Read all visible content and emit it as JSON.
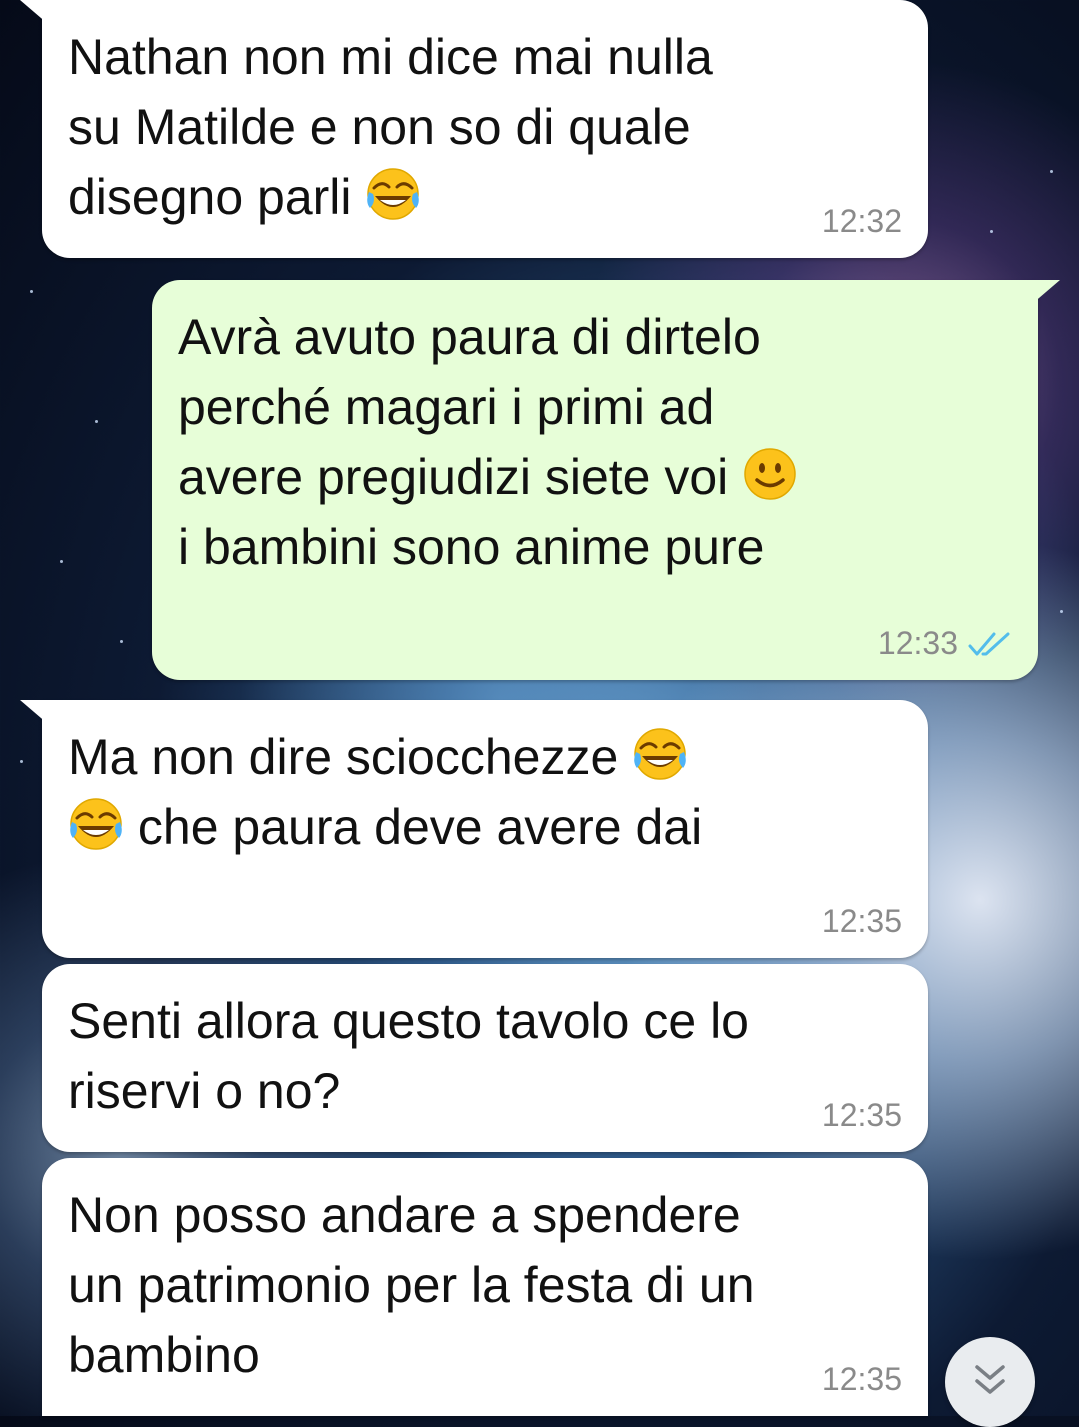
{
  "conversation": {
    "messages": [
      {
        "direction": "incoming",
        "text": "Nathan non mi dice mai nulla\nsu Matilde e non so di quale\ndisegno parli",
        "emoji": "face-with-tears-of-joy",
        "time": "12:32"
      },
      {
        "direction": "outgoing",
        "line1": "Avrà avuto paura di dirtelo",
        "line2": "perché magari i primi ad",
        "line3": "avere pregiudizi siete voi",
        "line4": "i bambini sono anime pure",
        "emoji": "slightly-smiling-face",
        "time": "12:33",
        "status": "read",
        "tick_color": "#53bdeb"
      },
      {
        "direction": "incoming",
        "line1": "Ma non dire sciocchezze",
        "line2": "che paura deve avere dai",
        "emoji": "face-with-tears-of-joy",
        "time": "12:35"
      },
      {
        "direction": "incoming",
        "text": "Senti allora questo tavolo ce lo\nriservi o no?",
        "time": "12:35"
      },
      {
        "direction": "incoming",
        "text": "Non posso andare a spendere\nun patrimonio per la festa di un\nbambino",
        "time": "12:35"
      }
    ]
  },
  "scroll_button": {
    "icon": "double-chevron-down-icon"
  },
  "colors": {
    "incoming_bubble": "#ffffff",
    "outgoing_bubble": "#e7fed8",
    "read_ticks": "#53bdeb"
  }
}
